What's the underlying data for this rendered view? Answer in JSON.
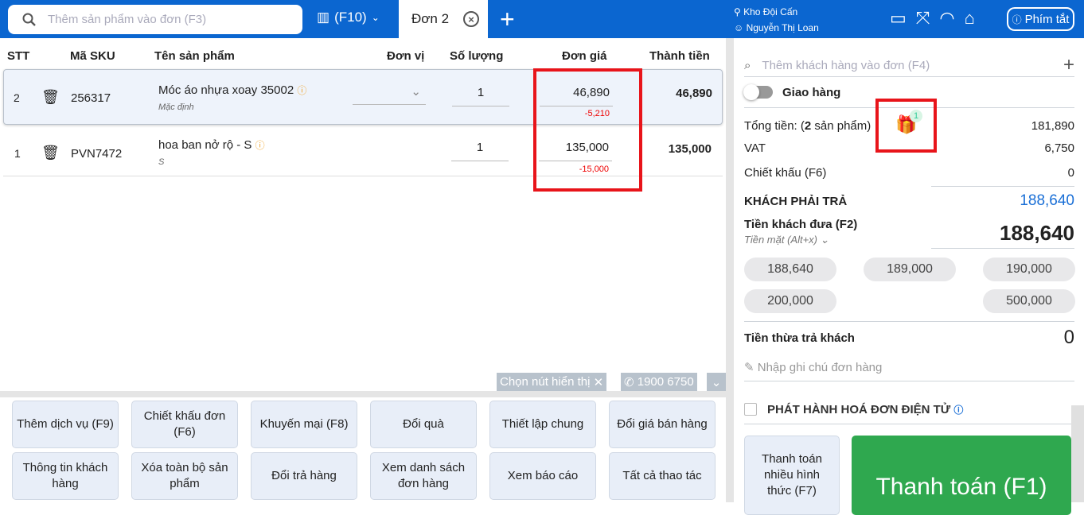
{
  "header": {
    "search_placeholder": "Thêm sản phẩm vào đơn (F3)",
    "scanner_label": "(F10)",
    "tab_label": "Đơn 2",
    "warehouse": "Kho Đội Cấn",
    "user": "Nguyễn Thị Loan",
    "shortcuts_label": "Phím tắt"
  },
  "table": {
    "columns": [
      "STT",
      "Mã SKU",
      "Tên sản phẩm",
      "Đơn vị",
      "Số lượng",
      "Đơn giá",
      "Thành tiền"
    ],
    "rows": [
      {
        "stt": "2",
        "sku": "256317",
        "name": "Móc áo nhựa xoay 35002",
        "variant": "Mặc định",
        "qty": "1",
        "price": "46,890",
        "discount": "-5,210",
        "total": "46,890"
      },
      {
        "stt": "1",
        "sku": "PVN7472",
        "name": "hoa ban nở rộ - S",
        "variant": "S",
        "qty": "1",
        "price": "135,000",
        "discount": "-15,000",
        "total": "135,000"
      }
    ]
  },
  "toolbar": {
    "choose_label": "Chọn nút hiển thị",
    "hotline": "1900 6750"
  },
  "actions": [
    "Thêm dịch vụ (F9)",
    "Chiết khấu đơn (F6)",
    "Khuyến mại (F8)",
    "Đổi quà",
    "Thiết lập chung",
    "Đổi giá bán hàng",
    "Thông tin khách hàng",
    "Xóa toàn bộ sản phẩm",
    "Đổi trả hàng",
    "Xem danh sách đơn hàng",
    "Xem báo cáo",
    "Tất cả thao tác"
  ],
  "summary": {
    "customer_placeholder": "Thêm khách hàng vào đơn (F4)",
    "delivery_label": "Giao hàng",
    "total_label_pre": "Tổng tiền: (",
    "total_count": "2",
    "total_label_post": " sản phẩm)",
    "gift_count": "1",
    "total": "181,890",
    "vat_label": "VAT",
    "vat": "6,750",
    "discount_label": "Chiết khấu (F6)",
    "discount": "0",
    "due_label": "KHÁCH PHẢI TRẢ",
    "due": "188,640",
    "paid_label": "Tiền khách đưa (F2)",
    "method": "Tiền mặt (Alt+x)",
    "paid": "188,640",
    "quick_amounts": [
      "188,640",
      "189,000",
      "190,000",
      "200,000",
      "500,000"
    ],
    "change_label": "Tiền thừa trả khách",
    "change": "0",
    "note_placeholder": "Nhập ghi chú đơn hàng",
    "einvoice_label": "PHÁT HÀNH HOÁ ĐƠN ĐIỆN TỬ",
    "multi_pay_label": "Thanh toán nhiều hình thức (F7)",
    "pay_label": "Thanh toán (F1)"
  },
  "colors": {
    "brand": "#0b66d0",
    "pay": "#2fa84f",
    "due": "#1a6fd6",
    "highlight": "#e8141a"
  }
}
